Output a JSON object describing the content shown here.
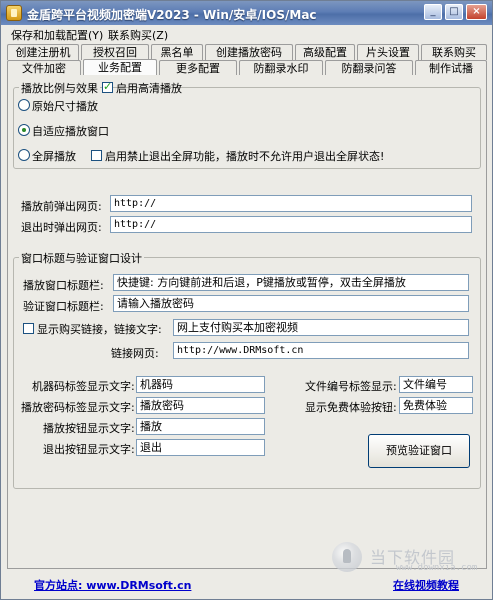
{
  "window": {
    "title": "金盾跨平台视频加密端V2023 - Win/安卓/IOS/Mac",
    "min_icon": "minimize-icon",
    "max_icon": "maximize-icon",
    "close_icon": "close-icon"
  },
  "menu": [
    "保存和加载配置(Y)",
    "联系购买(Z)"
  ],
  "tabs_row1": [
    "创建注册机",
    "授权召回",
    "黑名单",
    "创建播放密码",
    "高级配置",
    "片头设置",
    "联系购买"
  ],
  "tabs_row2": [
    "文件加密",
    "业务配置",
    "更多配置",
    "防翻录水印",
    "防翻录问答",
    "制作试播"
  ],
  "active_tab": "业务配置",
  "playback": {
    "legend": "播放比例与效果",
    "hd_label": "启用高清播放",
    "hd_checked": true,
    "original_size": "原始尺寸播放",
    "adaptive": "自适应播放窗口",
    "fullscreen": "全屏播放",
    "forbid_exit_label": "启用禁止退出全屏功能，播放时不允许用户退出全屏状态!",
    "forbid_exit_checked": false
  },
  "popup": {
    "before_label": "播放前弹出网页:",
    "before_value": "http://",
    "after_label": "退出时弹出网页:",
    "after_value": "http://"
  },
  "window_title_group": {
    "legend": "窗口标题与验证窗口设计",
    "play_title_label": "播放窗口标题栏:",
    "play_title_value": "快捷键: 方向键前进和后退，P键播放或暂停，双击全屏播放",
    "verify_title_label": "验证窗口标题栏:",
    "verify_title_value": "请输入播放密码",
    "buy_link_label": "显示购买链接，链接文字:",
    "buy_link_checked": false,
    "buy_link_value": "网上支付购买本加密视频",
    "link_url_label": "链接网页:",
    "link_url_value": "http://www.DRMsoft.cn",
    "machine_code_label": "机器码标签显示文字:",
    "machine_code_value": "机器码",
    "play_password_label": "播放密码标签显示文字:",
    "play_password_value": "播放密码",
    "play_button_label": "播放按钮显示文字:",
    "play_button_value": "播放",
    "exit_button_label": "退出按钮显示文字:",
    "exit_button_value": "退出",
    "file_no_label": "文件编号标签显示:",
    "file_no_value": "文件编号",
    "free_trial_label": "显示免费体验按钮:",
    "free_trial_value": "免费体验",
    "preview_button": "预览验证窗口"
  },
  "footer": {
    "official_site": "官方站点: www.DRMsoft.cn",
    "video_tutorial": "在线视频教程"
  },
  "watermark": {
    "text": "当下软件园",
    "sub": "www.downxia.com"
  }
}
